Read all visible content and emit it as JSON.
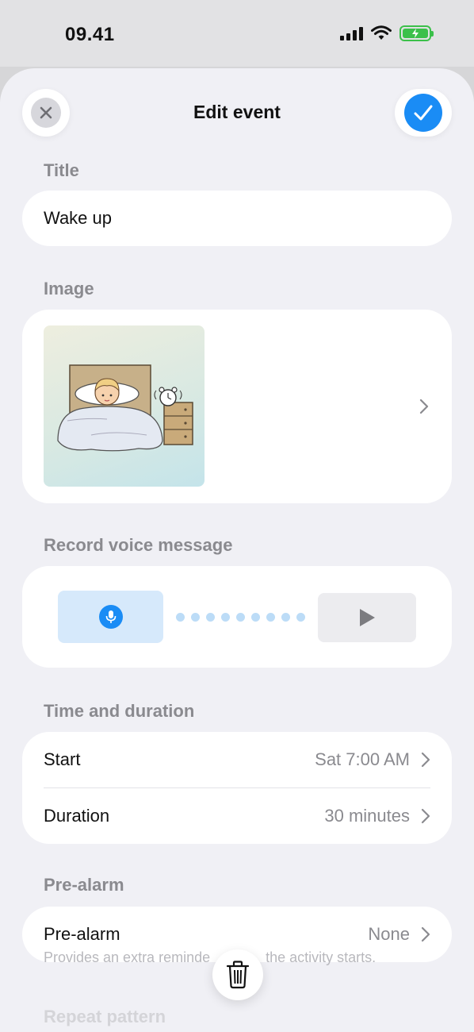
{
  "status_bar": {
    "time": "09.41",
    "icons": [
      "signal-icon",
      "wifi-icon",
      "battery-charging-icon"
    ],
    "battery_color": "#3bc04a"
  },
  "header": {
    "title": "Edit event",
    "close_icon": "close-icon",
    "confirm_icon": "checkmark-icon",
    "accent_color": "#1a8cf5"
  },
  "title_section": {
    "label": "Title",
    "value": "Wake up"
  },
  "image_section": {
    "label": "Image",
    "image_icon": "wake-up-illustration"
  },
  "voice_section": {
    "label": "Record voice message",
    "record_icon": "microphone-icon",
    "play_icon": "play-icon"
  },
  "time_section": {
    "label": "Time and duration",
    "rows": [
      {
        "label": "Start",
        "value": "Sat 7:00 AM"
      },
      {
        "label": "Duration",
        "value": "30 minutes"
      }
    ]
  },
  "prealarm_section": {
    "label": "Pre-alarm",
    "row_label": "Pre-alarm",
    "row_value": "None",
    "footnote_left": "Provides an extra reminde",
    "footnote_right": "the activity starts."
  },
  "repeat_section": {
    "label": "Repeat pattern"
  },
  "delete_icon": "trash-icon"
}
